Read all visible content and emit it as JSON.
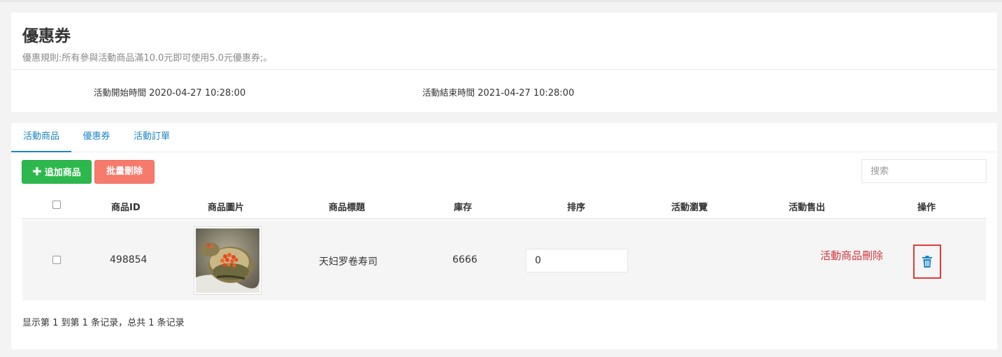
{
  "coupon": {
    "title": "優惠券",
    "rule": "優惠規則:所有參與活動商品滿10.0元即可使用5.0元優惠券;。",
    "start_label": "活動開始時間",
    "start_value": "2020-04-27 10:28:00",
    "end_label": "活動結束時間",
    "end_value": "2021-04-27 10:28:00"
  },
  "tabs": [
    {
      "label": "活動商品",
      "active": true
    },
    {
      "label": "優惠券",
      "active": false
    },
    {
      "label": "活動訂單",
      "active": false
    }
  ],
  "toolbar": {
    "add_label": "追加商品",
    "batch_delete_label": "批量刪除",
    "search_placeholder": "搜索"
  },
  "table": {
    "headers": [
      "商品ID",
      "商品圖片",
      "商品標題",
      "庫存",
      "排序",
      "活動瀏覽",
      "活動售出",
      "操作"
    ],
    "rows": [
      {
        "id": "498854",
        "image": "sushi-roll-photo",
        "title": "天妇罗卷寿司",
        "stock": "6666",
        "sort": "0",
        "views": "",
        "sold": "",
        "annotation": "活動商品刪除",
        "action_icon": "trash-icon"
      }
    ]
  },
  "footer": {
    "summary": "显示第 1 到第 1 条记录，总共 1 条记录"
  },
  "colors": {
    "accent": "#1c84c6",
    "add_button": "#2db84d",
    "delete_button": "#f77b6d",
    "highlight_red": "#e53935"
  }
}
